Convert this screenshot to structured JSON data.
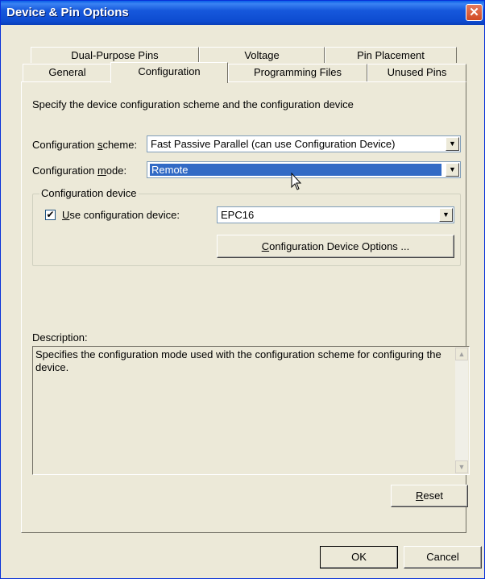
{
  "window": {
    "title": "Device & Pin Options",
    "close_glyph": "✕"
  },
  "tabs_row1": [
    {
      "label": "Dual-Purpose Pins"
    },
    {
      "label": "Voltage"
    },
    {
      "label": "Pin Placement"
    }
  ],
  "tabs_row2": [
    {
      "label": "General"
    },
    {
      "label": "Configuration",
      "active": true
    },
    {
      "label": "Programming Files"
    },
    {
      "label": "Unused Pins"
    }
  ],
  "panel": {
    "intro": "Specify the device configuration scheme and the configuration device",
    "scheme": {
      "label_pre": "Configuration ",
      "label_key": "s",
      "label_post": "cheme:",
      "value": "Fast Passive Parallel (can use Configuration Device)"
    },
    "mode": {
      "label_pre": "Configuration ",
      "label_key": "m",
      "label_post": "ode:",
      "value": "Remote"
    },
    "group": {
      "title": "Configuration device",
      "checkbox_label_key": "U",
      "checkbox_label_post": "se configuration device:",
      "checked": true,
      "check_glyph": "✔",
      "device_value": "EPC16",
      "options_button_key": "C",
      "options_button_post": "onfiguration Device Options ..."
    },
    "description": {
      "label": "Description:",
      "text": "Specifies the configuration mode used with the configuration scheme for configuring the device."
    },
    "reset_key": "R",
    "reset_post": "eset"
  },
  "footer": {
    "ok_label": "OK",
    "cancel_label": "Cancel"
  },
  "icons": {
    "dropdown": "▼",
    "scroll_up": "▲",
    "scroll_down": "▼"
  }
}
